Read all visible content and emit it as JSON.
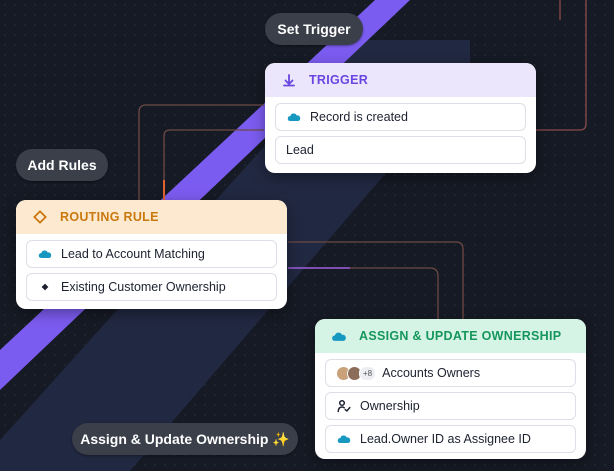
{
  "labels": {
    "set_trigger": "Set Trigger",
    "add_rules": "Add Rules",
    "assign_update": "Assign & Update Ownership",
    "sparkle": "✨"
  },
  "trigger": {
    "title": "TRIGGER",
    "rows": [
      "Record is created",
      "Lead"
    ]
  },
  "routing": {
    "title": "ROUTING RULE",
    "rows": [
      "Lead to Account Matching",
      "Existing Customer Ownership"
    ]
  },
  "assign": {
    "title": "ASSIGN & UPDATE OWNERSHIP",
    "rows": [
      "Accounts Owners",
      "Ownership",
      "Lead.Owner ID as Assignee ID"
    ],
    "avatar_more": "+8"
  },
  "colors": {
    "background": "#161a24",
    "band": "#7b5cf0",
    "trigger_accent": "#6a45e0",
    "routing_accent": "#c9790e",
    "assign_accent": "#16965c",
    "salesforce": "#1798c1"
  },
  "icons": {
    "trigger": "arrow-down-to-line-icon",
    "routing": "diamond-icon",
    "assign": "salesforce-cloud-icon",
    "rows": [
      "salesforce-cloud-icon",
      "diamond-small-icon",
      "avatar-group-icon",
      "user-check-icon"
    ]
  }
}
